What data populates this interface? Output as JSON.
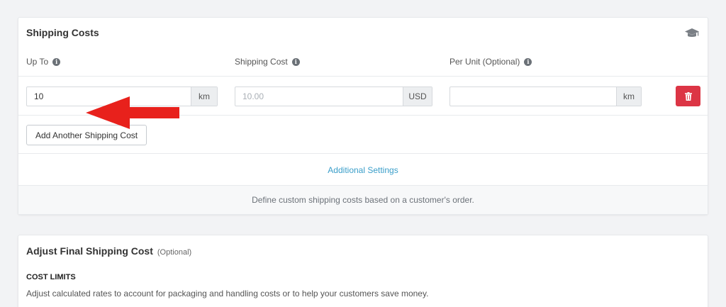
{
  "shipping_costs": {
    "title": "Shipping Costs",
    "help_icon": "graduation-cap-icon",
    "columns": {
      "up_to": "Up To",
      "shipping_cost": "Shipping Cost",
      "per_unit": "Per Unit (Optional)"
    },
    "row": {
      "up_to_value": "10",
      "up_to_unit": "km",
      "shipping_cost_value": "",
      "shipping_cost_placeholder": "10.00",
      "shipping_cost_unit": "USD",
      "per_unit_value": "",
      "per_unit_unit": "km",
      "delete_icon": "trash-icon"
    },
    "add_button": "Add Another Shipping Cost",
    "additional_settings_link": "Additional Settings",
    "footer_note": "Define custom shipping costs based on a customer's order."
  },
  "adjust_final": {
    "title": "Adjust Final Shipping Cost",
    "optional_label": "(Optional)",
    "section_heading": "COST LIMITS",
    "description": "Adjust calculated rates to account for packaging and handling costs or to help your customers save money."
  },
  "colors": {
    "accent_link": "#3a9ec9",
    "danger": "#dc3545",
    "annotation_arrow": "#e8211c"
  }
}
